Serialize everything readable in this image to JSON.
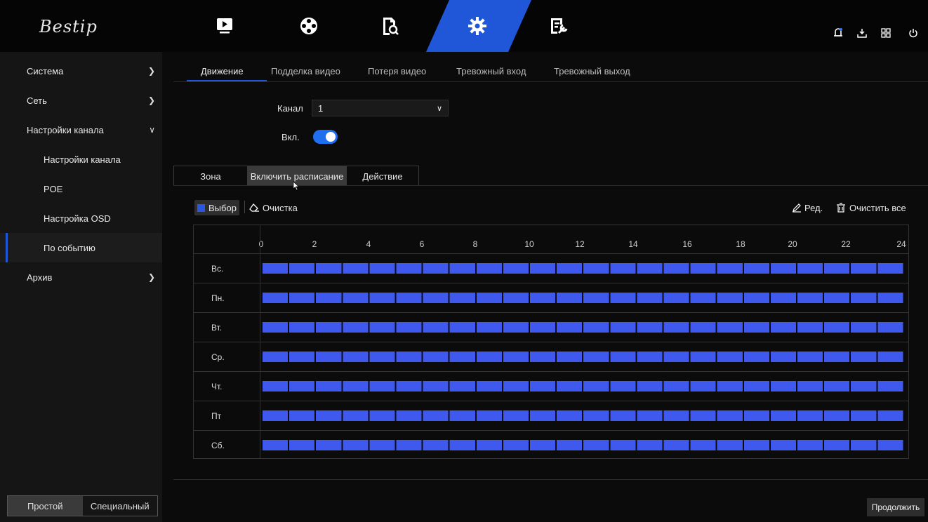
{
  "app": {
    "logo_text": "Bestip"
  },
  "top_nav": {
    "icons": [
      "playback-icon",
      "film-reel-icon",
      "search-file-icon",
      "gear-icon",
      "maintenance-icon"
    ],
    "active": "gear-icon",
    "right_icons": [
      "notification-icon",
      "download-icon",
      "layout-grid-icon",
      "power-icon"
    ]
  },
  "sidebar": {
    "items": [
      {
        "label": "Система",
        "chevron": ">"
      },
      {
        "label": "Сеть",
        "chevron": ">"
      },
      {
        "label": "Настройки канала",
        "chevron": "v"
      },
      {
        "label": "Настройки канала"
      },
      {
        "label": "POE"
      },
      {
        "label": "Настройка OSD"
      },
      {
        "label": "По событию"
      },
      {
        "label": "Архив",
        "chevron": ">"
      }
    ],
    "mode": {
      "simple": "Простой",
      "advanced": "Специальный",
      "selected": "Простой"
    }
  },
  "tabs": [
    "Движение",
    "Подделка видео",
    "Потеря видео",
    "Тревожный вход",
    "Тревожный выход"
  ],
  "form": {
    "channel_label": "Канал",
    "channel_value": "1",
    "enable_label": "Вкл.",
    "enable_on": true
  },
  "subtabs": [
    "Зона",
    "Включить расписание",
    "Действие"
  ],
  "toolbar": {
    "select_label": "Выбор",
    "erase_label": "Очистка",
    "edit_label": "Ред.",
    "clear_all_label": "Очистить все"
  },
  "schedule": {
    "hours": [
      "0",
      "2",
      "4",
      "6",
      "8",
      "10",
      "12",
      "14",
      "16",
      "18",
      "20",
      "22",
      "24"
    ],
    "days": [
      "Вс.",
      "Пн.",
      "Вт.",
      "Ср.",
      "Чт.",
      "Пт",
      "Сб."
    ],
    "filled_fraction": 1.0,
    "fill_color": "#3f59ee"
  },
  "continue_label": "Продолжить",
  "colors": {
    "accent": "#1f57d8",
    "schedule_fill": "#3f59ee"
  }
}
